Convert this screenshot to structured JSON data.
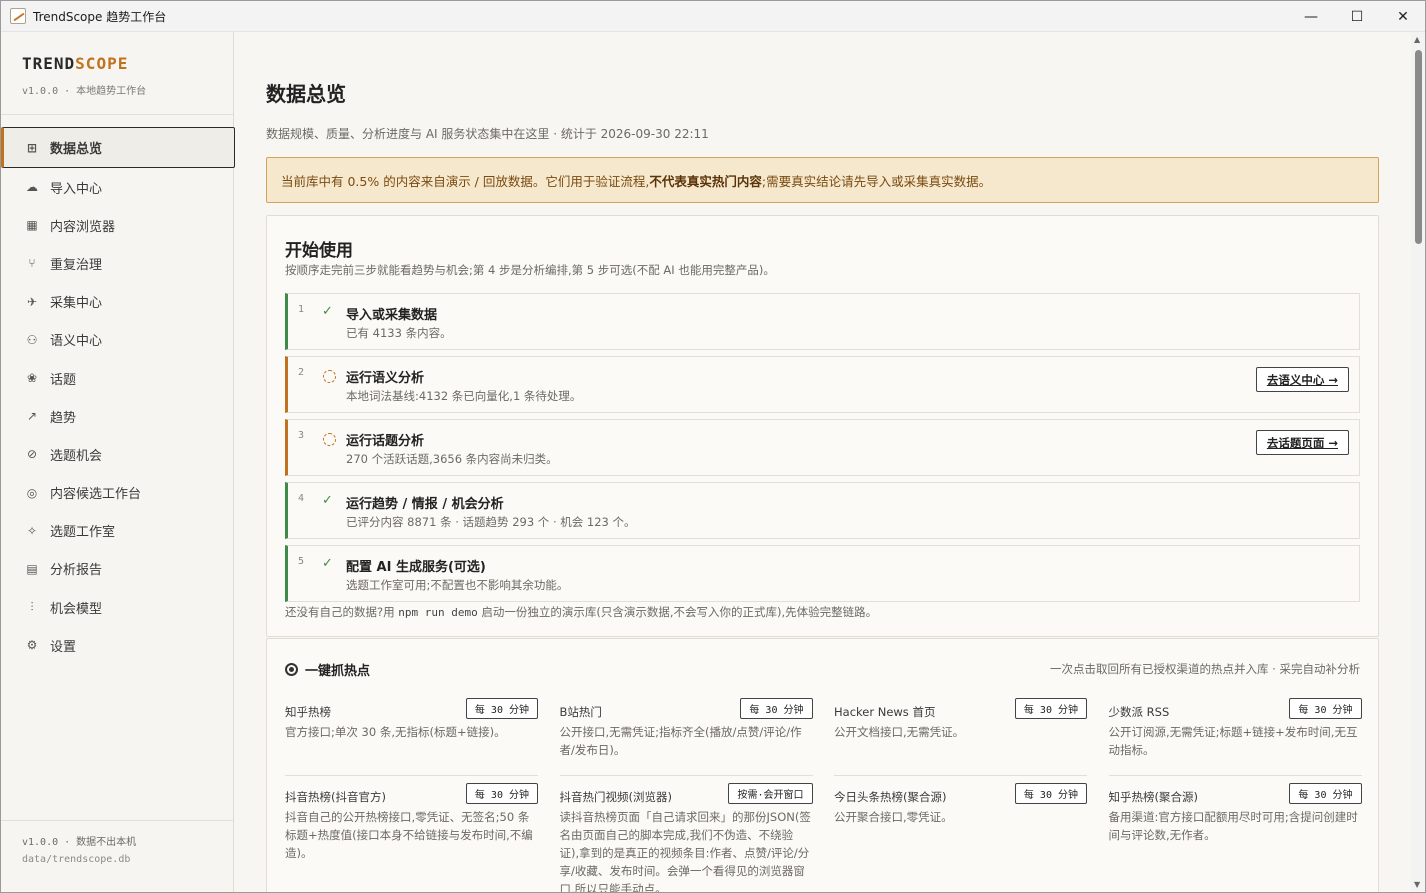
{
  "window": {
    "title": "TrendScope 趋势工作台",
    "minimize": "—",
    "maximize": "☐",
    "close": "✕"
  },
  "sidebar": {
    "brand_a": "TREND",
    "brand_b": "SCOPE",
    "version_line": "v1.0.0 · 本地趋势工作台",
    "items": [
      {
        "label": "数据总览",
        "icon": "grid-icon",
        "glyph": "⊞"
      },
      {
        "label": "导入中心",
        "icon": "cloud-upload-icon",
        "glyph": "☁"
      },
      {
        "label": "内容浏览器",
        "icon": "table-icon",
        "glyph": "▦"
      },
      {
        "label": "重复治理",
        "icon": "merge-icon",
        "glyph": "⑂"
      },
      {
        "label": "采集中心",
        "icon": "satellite-icon",
        "glyph": "✈"
      },
      {
        "label": "语义中心",
        "icon": "network-icon",
        "glyph": "⚇"
      },
      {
        "label": "话题",
        "icon": "cluster-icon",
        "glyph": "❀"
      },
      {
        "label": "趋势",
        "icon": "trend-icon",
        "glyph": "↗"
      },
      {
        "label": "选题机会",
        "icon": "compass-icon",
        "glyph": "⊘"
      },
      {
        "label": "内容候选工作台",
        "icon": "target-icon",
        "glyph": "◎"
      },
      {
        "label": "选题工作室",
        "icon": "sparkles-icon",
        "glyph": "✧"
      },
      {
        "label": "分析报告",
        "icon": "document-icon",
        "glyph": "▤"
      },
      {
        "label": "机会模型",
        "icon": "sliders-icon",
        "glyph": "⫶"
      },
      {
        "label": "设置",
        "icon": "settings-icon",
        "glyph": "⚙"
      }
    ],
    "footer_version": "v1.0.0 · 数据不出本机",
    "footer_db": "data/trendscope.db"
  },
  "main": {
    "title": "数据总览",
    "subtitle": "数据规模、质量、分析进度与 AI 服务状态集中在这里 · 统计于 2026-09-30 22:11",
    "warning_a": "当前库中有 0.5% 的内容来自演示 / 回放数据。它们用于验证流程,",
    "warning_b": "不代表真实热门内容",
    "warning_c": ";需要真实结论请先导入或采集真实数据。"
  },
  "getting_started": {
    "title": "开始使用",
    "subtitle": "按顺序走完前三步就能看趋势与机会;第 4 步是分析编排,第 5 步可选(不配 AI 也能用完整产品)。",
    "steps": [
      {
        "num": "1",
        "status": "done",
        "title": "导入或采集数据",
        "desc": "已有 4133 条内容。"
      },
      {
        "num": "2",
        "status": "pending",
        "title": "运行语义分析",
        "desc": "本地词法基线:4132 条已向量化,1 条待处理。",
        "button": "去语义中心 →"
      },
      {
        "num": "3",
        "status": "pending",
        "title": "运行话题分析",
        "desc": "270 个活跃话题,3656 条内容尚未归类。",
        "button": "去话题页面 →"
      },
      {
        "num": "4",
        "status": "done",
        "title": "运行趋势 / 情报 / 机会分析",
        "desc": "已评分内容 8871 条 · 话题趋势 293 个 · 机会 123 个。"
      },
      {
        "num": "5",
        "status": "done",
        "title": "配置 AI 生成服务(可选)",
        "desc": "选题工作室可用;不配置也不影响其余功能。"
      }
    ],
    "check_glyph": "✓",
    "demo_a": "还没有自己的数据?用 ",
    "demo_code": "npm run demo",
    "demo_b": " 启动一份独立的演示库(只含演示数据,不会写入你的正式库),先体验完整链路。"
  },
  "hot": {
    "title": "一键抓热点",
    "right_note": "一次点击取回所有已授权渠道的热点并入库 · 采完自动补分析",
    "sources": [
      {
        "name": "知乎热榜",
        "badge": "每 30 分钟",
        "desc": "官方接口;单次 30 条,无指标(标题+链接)。"
      },
      {
        "name": "B站热门",
        "badge": "每 30 分钟",
        "desc": "公开接口,无需凭证;指标齐全(播放/点赞/评论/作者/发布日)。"
      },
      {
        "name": "Hacker News 首页",
        "badge": "每 30 分钟",
        "desc": "公开文档接口,无需凭证。"
      },
      {
        "name": "少数派 RSS",
        "badge": "每 30 分钟",
        "desc": "公开订阅源,无需凭证;标题+链接+发布时间,无互动指标。"
      },
      {
        "name": "抖音热榜(抖音官方)",
        "badge": "每 30 分钟",
        "desc": "抖音自己的公开热榜接口,零凭证、无签名;50 条标题+热度值(接口本身不给链接与发布时间,不编造)。"
      },
      {
        "name": "抖音热门视频(浏览器)",
        "badge": "按需·会开窗口",
        "desc": "读抖音热榜页面「自己请求回来」的那份JSON(签名由页面自己的脚本完成,我们不伪造、不绕验证),拿到的是真正的视频条目:作者、点赞/评论/分享/收藏、发布时间。会弹一个看得见的浏览器窗口,所以只能手动点。"
      },
      {
        "name": "今日头条热榜(聚合源)",
        "badge": "每 30 分钟",
        "desc": "公开聚合接口,零凭证。"
      },
      {
        "name": "知乎热榜(聚合源)",
        "badge": "每 30 分钟",
        "desc": "备用渠道:官方接口配额用尽时可用;含提问创建时间与评论数,无作者。"
      }
    ]
  }
}
